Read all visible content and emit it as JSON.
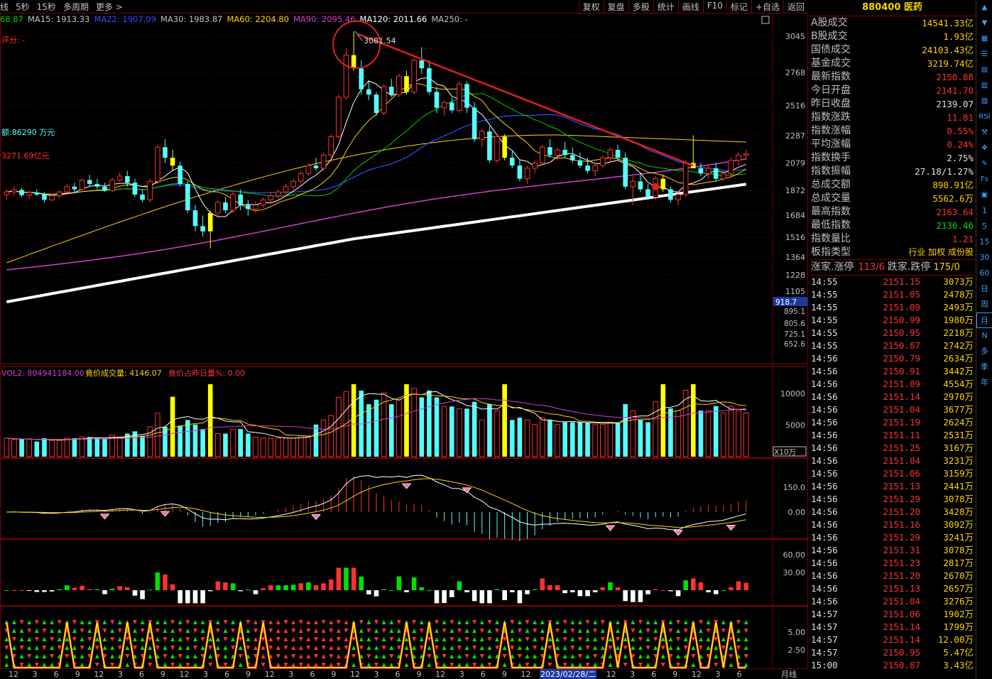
{
  "toolbar": {
    "left_items": [
      "线",
      "5秒",
      "15秒",
      "多周期",
      "更多 >"
    ],
    "right_items": [
      "复权",
      "复盘",
      "多股",
      "统计",
      "画线",
      "F10",
      "标记",
      "+自选",
      "返回"
    ]
  },
  "ma_legend": [
    {
      "text": "68.87",
      "color": "#00d000"
    },
    {
      "text": "MA15: 1913.33",
      "color": "#c0c0c0"
    },
    {
      "text": "MA22: 1907.09",
      "color": "#3050ff"
    },
    {
      "text": "MA30: 1983.87",
      "color": "#c0c0c0"
    },
    {
      "text": "MA60: 2204.80",
      "color": "#ffd200"
    },
    {
      "text": "MA90: 2095.46",
      "color": "#d040d0"
    },
    {
      "text": "MA120: 2011.66",
      "color": "#ffffff"
    },
    {
      "text": "MA250: -",
      "color": "#c0c0c0"
    }
  ],
  "main_annotations": {
    "rating": "评分: -",
    "amount": "额:86290 万元",
    "amount2": "3271.69亿元",
    "peak_label": "3081.54"
  },
  "colors": {
    "up": "#ff3232",
    "down": "#54ffff",
    "yellow": "#ffff00",
    "grid": "#800000",
    "ma5": "#ffffff",
    "ma10": "#ffd200",
    "ma15": "#d040d0",
    "ma20": "#00d000",
    "ma30": "#3050ff",
    "ma120": "#ffffff",
    "trend": "#e02020",
    "accent": "#ffd200"
  },
  "price_axis": [
    "3045",
    "2768",
    "2516",
    "2287",
    "2079",
    "1872",
    "1684",
    "1516",
    "1364",
    "1228",
    "1105"
  ],
  "price_axis_lower": [
    "918.7",
    "895.1",
    "805.6",
    "725.1",
    "652.6"
  ],
  "vol_header": {
    "vol2": "VOL2: 804941184.00",
    "auction": "竟价成交量: 4146.07",
    "ratio": "竟价占昨日量%: 0.00"
  },
  "vol_axis": [
    "10000",
    "5000"
  ],
  "vol_unit": "X10万",
  "macd_axis": [
    "150.0",
    "0.00"
  ],
  "osc_axis": [
    "60.00",
    "30.00"
  ],
  "sig_axis": [
    "5.00",
    "2.50"
  ],
  "x_axis": {
    "ticks": [
      "12",
      "3",
      "6",
      "9",
      "12",
      "3",
      "6",
      "9",
      "12",
      "3",
      "6",
      "9",
      "12",
      "3",
      "6",
      "9",
      "12",
      "3",
      "6",
      "9",
      "12",
      "3",
      "6",
      "9",
      "12",
      "3",
      "6",
      "9",
      "12",
      "3",
      "6",
      "9",
      "12",
      "3",
      "6"
    ],
    "cursor_date": "2023/02/28/二",
    "period": "月线"
  },
  "chart_data": {
    "type": "candlestick",
    "title": "880400 医药",
    "period": "月线",
    "ylim": [
      1105,
      3081.54
    ],
    "peak": 3081.54,
    "last_close": 2150.87,
    "note_series": "approximate monthly OHLC read off the chart",
    "candles": [
      [
        1840,
        1880,
        1800,
        1860
      ],
      [
        1860,
        1900,
        1830,
        1875
      ],
      [
        1875,
        1890,
        1820,
        1835
      ],
      [
        1835,
        1870,
        1800,
        1855
      ],
      [
        1855,
        1880,
        1830,
        1840
      ],
      [
        1840,
        1860,
        1780,
        1800
      ],
      [
        1800,
        1850,
        1790,
        1830
      ],
      [
        1830,
        1870,
        1810,
        1860
      ],
      [
        1860,
        1920,
        1840,
        1900
      ],
      [
        1900,
        1930,
        1850,
        1880
      ],
      [
        1880,
        1960,
        1870,
        1950
      ],
      [
        1950,
        1990,
        1900,
        1920
      ],
      [
        1920,
        1960,
        1880,
        1900
      ],
      [
        1900,
        1930,
        1860,
        1870
      ],
      [
        1870,
        1970,
        1860,
        1950
      ],
      [
        1950,
        2010,
        1920,
        1980
      ],
      [
        1980,
        2020,
        1900,
        1930
      ],
      [
        1930,
        1960,
        1820,
        1840
      ],
      [
        1840,
        1880,
        1780,
        1800
      ],
      [
        1800,
        1960,
        1780,
        1940
      ],
      [
        1940,
        2220,
        1920,
        2200
      ],
      [
        2200,
        2260,
        2080,
        2120
      ],
      [
        2120,
        2180,
        2020,
        2060
      ],
      [
        2060,
        2090,
        1900,
        1920
      ],
      [
        1920,
        1940,
        1700,
        1720
      ],
      [
        1720,
        1760,
        1560,
        1600
      ],
      [
        1600,
        1680,
        1520,
        1560
      ],
      [
        1560,
        1720,
        1430,
        1700
      ],
      [
        1700,
        1800,
        1680,
        1780
      ],
      [
        1780,
        1820,
        1700,
        1720
      ],
      [
        1720,
        1860,
        1700,
        1840
      ],
      [
        1840,
        1880,
        1720,
        1760
      ],
      [
        1760,
        1800,
        1680,
        1730
      ],
      [
        1730,
        1790,
        1700,
        1760
      ],
      [
        1760,
        1820,
        1740,
        1800
      ],
      [
        1800,
        1860,
        1780,
        1830
      ],
      [
        1830,
        1880,
        1800,
        1860
      ],
      [
        1860,
        1920,
        1840,
        1900
      ],
      [
        1900,
        1960,
        1880,
        1940
      ],
      [
        1940,
        2020,
        1920,
        2000
      ],
      [
        2000,
        2080,
        1980,
        2060
      ],
      [
        2060,
        2120,
        2020,
        2040
      ],
      [
        2040,
        2160,
        2020,
        2140
      ],
      [
        2140,
        2300,
        2120,
        2280
      ],
      [
        2280,
        2600,
        2260,
        2580
      ],
      [
        2580,
        2950,
        2560,
        2900
      ],
      [
        2900,
        3081,
        2780,
        2800
      ],
      [
        2800,
        2860,
        2600,
        2640
      ],
      [
        2640,
        2700,
        2560,
        2600
      ],
      [
        2600,
        2620,
        2440,
        2460
      ],
      [
        2460,
        2680,
        2440,
        2660
      ],
      [
        2660,
        2720,
        2580,
        2600
      ],
      [
        2600,
        2760,
        2580,
        2740
      ],
      [
        2740,
        2780,
        2600,
        2620
      ],
      [
        2620,
        2880,
        2600,
        2860
      ],
      [
        2860,
        2960,
        2760,
        2800
      ],
      [
        2800,
        2860,
        2600,
        2620
      ],
      [
        2620,
        2660,
        2460,
        2500
      ],
      [
        2500,
        2560,
        2440,
        2540
      ],
      [
        2540,
        2580,
        2460,
        2480
      ],
      [
        2480,
        2700,
        2460,
        2680
      ],
      [
        2680,
        2700,
        2460,
        2500
      ],
      [
        2500,
        2540,
        2240,
        2260
      ],
      [
        2260,
        2340,
        2200,
        2320
      ],
      [
        2320,
        2360,
        2080,
        2100
      ],
      [
        2100,
        2300,
        2080,
        2280
      ],
      [
        2280,
        2300,
        2100,
        2120
      ],
      [
        2120,
        2180,
        2040,
        2060
      ],
      [
        2060,
        2100,
        1940,
        1960
      ],
      [
        1960,
        2060,
        1920,
        2040
      ],
      [
        2040,
        2100,
        2000,
        2080
      ],
      [
        2080,
        2220,
        2060,
        2200
      ],
      [
        2200,
        2260,
        2120,
        2140
      ],
      [
        2140,
        2200,
        2100,
        2180
      ],
      [
        2180,
        2240,
        2120,
        2140
      ],
      [
        2140,
        2200,
        2080,
        2100
      ],
      [
        2100,
        2160,
        2040,
        2060
      ],
      [
        2060,
        2120,
        2000,
        2020
      ],
      [
        2020,
        2080,
        1980,
        2060
      ],
      [
        2060,
        2140,
        2040,
        2120
      ],
      [
        2120,
        2200,
        2080,
        2180
      ],
      [
        2180,
        2220,
        2100,
        2120
      ],
      [
        2120,
        2160,
        1880,
        1900
      ],
      [
        1900,
        1980,
        1760,
        1940
      ],
      [
        1940,
        2000,
        1860,
        1880
      ],
      [
        1880,
        1920,
        1800,
        1820
      ],
      [
        1820,
        1980,
        1800,
        1960
      ],
      [
        1960,
        1990,
        1860,
        1880
      ],
      [
        1880,
        1900,
        1780,
        1800
      ],
      [
        1800,
        1860,
        1760,
        1840
      ],
      [
        1840,
        2100,
        1820,
        2080
      ],
      [
        2080,
        2290,
        2060,
        2040
      ],
      [
        2040,
        2080,
        1980,
        2000
      ],
      [
        2000,
        2060,
        1960,
        2040
      ],
      [
        2040,
        2080,
        1940,
        1960
      ],
      [
        1960,
        2020,
        1940,
        2000
      ],
      [
        2000,
        2120,
        1980,
        2100
      ],
      [
        2100,
        2160,
        2060,
        2140
      ],
      [
        2140,
        2180,
        2100,
        2150.87
      ]
    ],
    "yellow_indices": [
      22,
      27,
      46,
      53,
      66,
      87,
      91
    ]
  },
  "side_panel": {
    "title": "880400 医药",
    "stats": [
      {
        "label": "A股成交",
        "value": "14541.33亿",
        "color": "#ffd200"
      },
      {
        "label": "B股成交",
        "value": "1.93亿",
        "color": "#ffd200"
      },
      {
        "label": "国债成交",
        "value": "24103.43亿",
        "color": "#ffd200"
      },
      {
        "label": "基金成交",
        "value": "3219.74亿",
        "color": "#ffd200"
      },
      {
        "label": "最新指数",
        "value": "2150.88",
        "color": "#ff3232"
      },
      {
        "label": "今日开盘",
        "value": "2141.70",
        "color": "#ff3232"
      },
      {
        "label": "昨日收盘",
        "value": "2139.07",
        "color": "#e0e0e0"
      },
      {
        "label": "指数涨跌",
        "value": "11.81",
        "color": "#ff3232"
      },
      {
        "label": "指数涨幅",
        "value": "0.55%",
        "color": "#ff3232"
      },
      {
        "label": "平均涨幅",
        "value": "0.24%",
        "color": "#ff3232"
      },
      {
        "label": "指数换手",
        "value": "2.75%",
        "color": "#e0e0e0"
      },
      {
        "label": "指数振幅",
        "value": "27.18/1.27%",
        "color": "#e0e0e0"
      },
      {
        "label": "总成交额",
        "value": "890.91亿",
        "color": "#ffd200"
      },
      {
        "label": "总成交量",
        "value": "5562.6万",
        "color": "#ffd200"
      },
      {
        "label": "最高指数",
        "value": "2163.64",
        "color": "#ff3232"
      },
      {
        "label": "最低指数",
        "value": "2136.46",
        "color": "#00e000"
      },
      {
        "label": "指数量比",
        "value": "1.21",
        "color": "#ff3232"
      },
      {
        "label": "板指类型",
        "value": "行业 加权 成份股",
        "color": "#ffd200"
      }
    ],
    "updown": {
      "label1": "涨家.涨停",
      "v1": "113/6",
      "label2": "跌家.跌停",
      "v2": "175/0"
    },
    "ticks": [
      [
        "14:55",
        "2151.15",
        "3073万"
      ],
      [
        "14:55",
        "2151.05",
        "2478万"
      ],
      [
        "14:55",
        "2151.00",
        "2493万"
      ],
      [
        "14:55",
        "2150.99",
        "1980万"
      ],
      [
        "14:55",
        "2150.95",
        "2218万"
      ],
      [
        "14:55",
        "2150.87",
        "2742万"
      ],
      [
        "14:56",
        "2150.79",
        "2634万"
      ],
      [
        "14:56",
        "2150.91",
        "3442万"
      ],
      [
        "14:56",
        "2151.09",
        "4554万"
      ],
      [
        "14:56",
        "2151.14",
        "2970万"
      ],
      [
        "14:56",
        "2151.04",
        "3677万"
      ],
      [
        "14:56",
        "2151.19",
        "2624万"
      ],
      [
        "14:56",
        "2151.11",
        "2531万"
      ],
      [
        "14:56",
        "2151.25",
        "3167万"
      ],
      [
        "14:56",
        "2151.04",
        "3231万"
      ],
      [
        "14:56",
        "2151.06",
        "3159万"
      ],
      [
        "14:56",
        "2151.13",
        "2441万"
      ],
      [
        "14:56",
        "2151.29",
        "3078万"
      ],
      [
        "14:56",
        "2151.20",
        "3428万"
      ],
      [
        "14:56",
        "2151.16",
        "3092万"
      ],
      [
        "14:56",
        "2151.29",
        "3241万"
      ],
      [
        "14:56",
        "2151.31",
        "3078万"
      ],
      [
        "14:56",
        "2151.23",
        "2817万"
      ],
      [
        "14:56",
        "2151.20",
        "2670万"
      ],
      [
        "14:56",
        "2151.13",
        "2657万"
      ],
      [
        "14:56",
        "2151.04",
        "3276万"
      ],
      [
        "14:57",
        "2151.06",
        "1902万"
      ],
      [
        "14:57",
        "2151.14",
        "1799万"
      ],
      [
        "14:57",
        "2151.14",
        "12.00万"
      ],
      [
        "14:57",
        "2150.95",
        "5.47亿"
      ],
      [
        "15:00",
        "2150.87",
        "3.43亿"
      ]
    ]
  },
  "icon_bar": [
    "up-arrow",
    "down-arrow",
    "grid",
    "list",
    "table",
    "chart",
    "doc",
    "rsi",
    "tools",
    "move",
    "pen",
    "Fs",
    "box",
    "1",
    "5",
    "15",
    "30",
    "60",
    "日",
    "周",
    "月",
    "N",
    "多",
    "季",
    "年"
  ]
}
